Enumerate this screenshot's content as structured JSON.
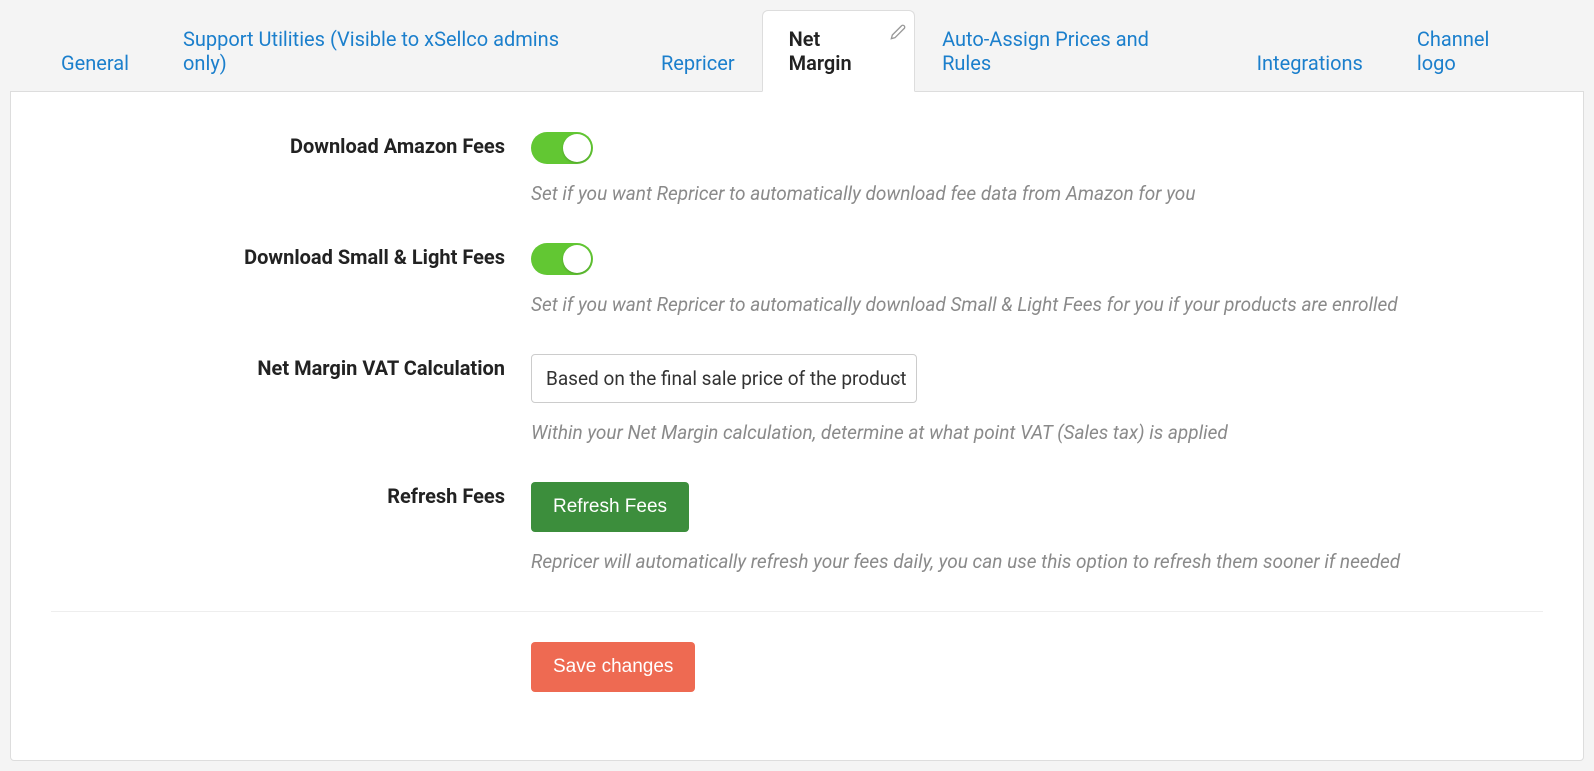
{
  "tabs": {
    "general": "General",
    "support_utilities": "Support Utilities (Visible to xSellco admins only)",
    "repricer": "Repricer",
    "net_margin": "Net Margin",
    "auto_assign": "Auto-Assign Prices and Rules",
    "integrations": "Integrations",
    "channel_logo": "Channel logo"
  },
  "fields": {
    "download_amazon_fees": {
      "label": "Download Amazon Fees",
      "help": "Set if you want Repricer to automatically download fee data from Amazon for you"
    },
    "download_small_light": {
      "label": "Download Small & Light Fees",
      "help": "Set if you want Repricer to automatically download Small & Light Fees for you if your products are enrolled"
    },
    "vat_calc": {
      "label": "Net Margin VAT Calculation",
      "selected": "Based on the final sale price of the product",
      "help": "Within your Net Margin calculation, determine at what point VAT (Sales tax) is applied"
    },
    "refresh_fees": {
      "label": "Refresh Fees",
      "button": "Refresh Fees",
      "help": "Repricer will automatically refresh your fees daily, you can use this option to refresh them sooner if needed"
    }
  },
  "actions": {
    "save": "Save changes"
  }
}
